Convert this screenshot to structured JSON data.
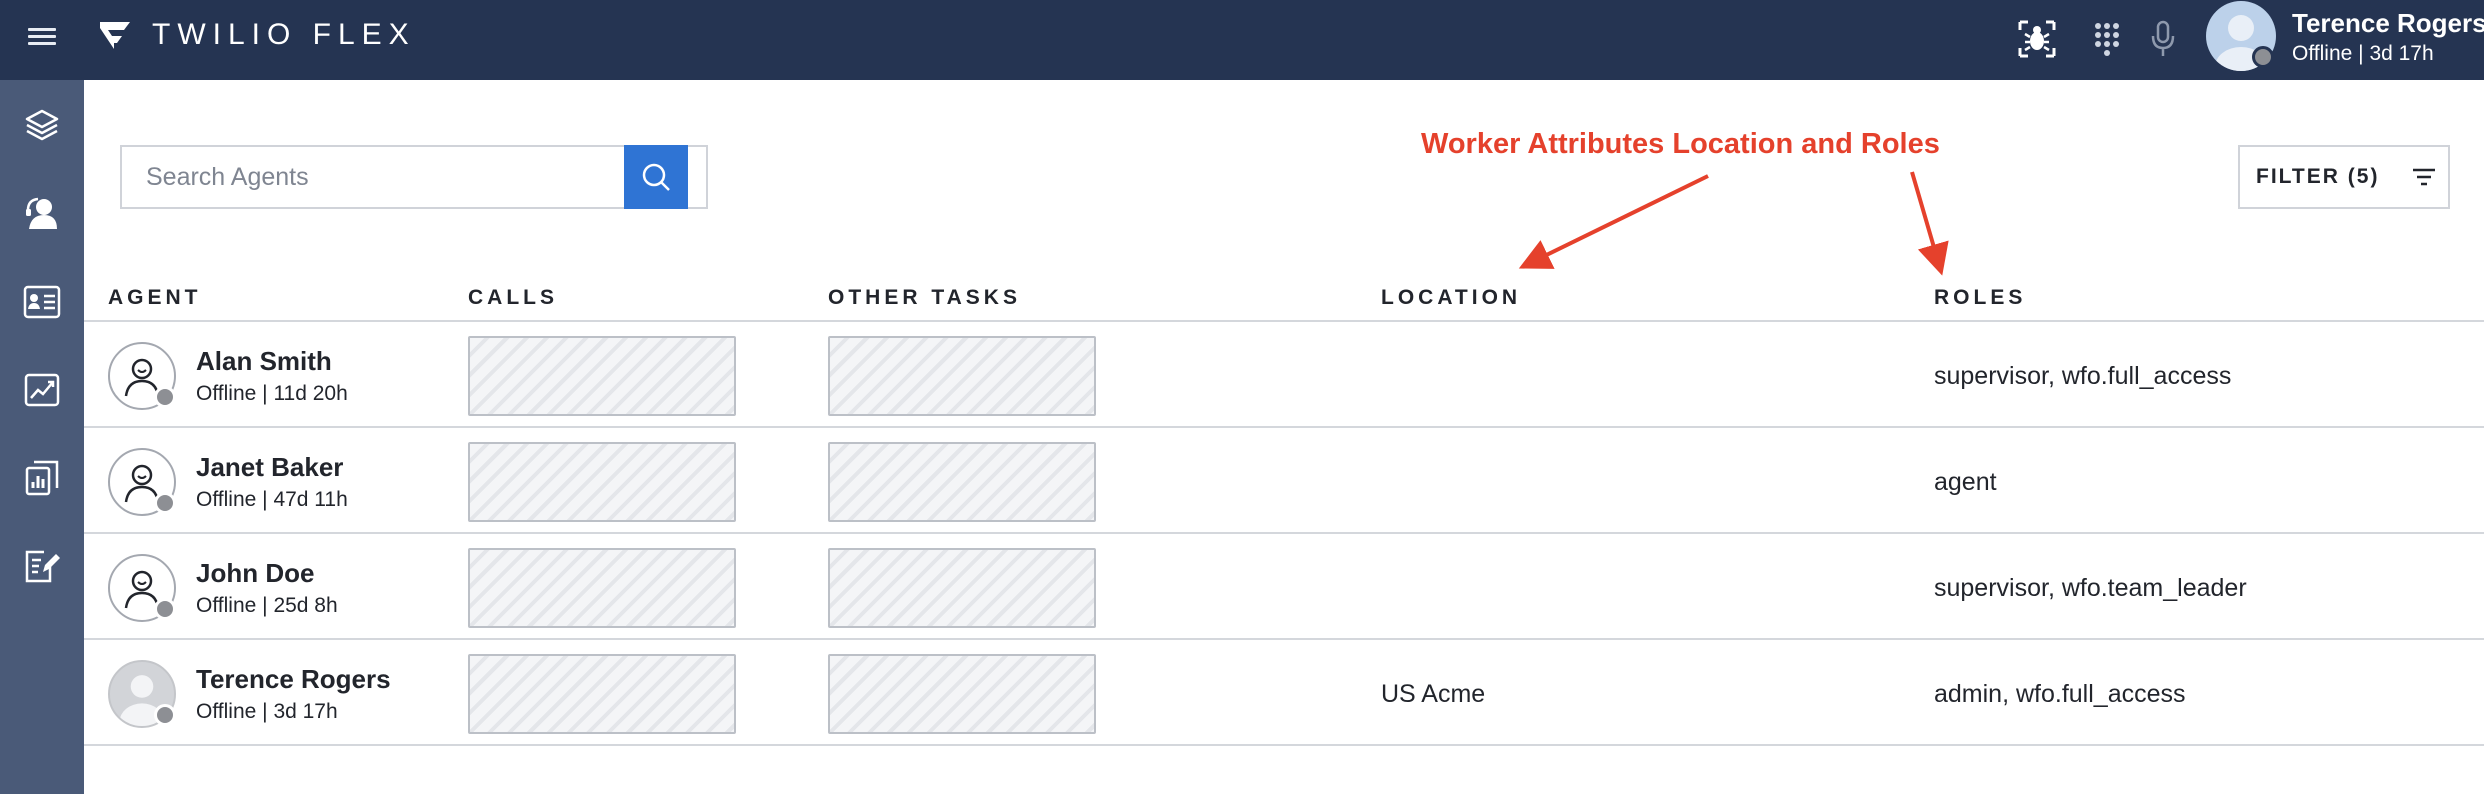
{
  "app": {
    "brand": "TWILIO FLEX"
  },
  "user": {
    "name": "Terence Rogers",
    "status": "Offline | 3d 17h"
  },
  "search": {
    "placeholder": "Search Agents"
  },
  "annotation": {
    "text": "Worker Attributes Location and Roles",
    "color": "#e5412c"
  },
  "filter": {
    "label": "FILTER (5)"
  },
  "columns": {
    "agent": "AGENT",
    "calls": "CALLS",
    "other_tasks": "OTHER TASKS",
    "location": "LOCATION",
    "roles": "ROLES"
  },
  "agents": [
    {
      "name": "Alan Smith",
      "status": "Offline | 11d 20h",
      "location": "",
      "roles": "supervisor, wfo.full_access",
      "avatar": "user-outline-icon"
    },
    {
      "name": "Janet Baker",
      "status": "Offline | 47d 11h",
      "location": "",
      "roles": "agent",
      "avatar": "user-outline-icon"
    },
    {
      "name": "John Doe",
      "status": "Offline | 25d 8h",
      "location": "",
      "roles": "supervisor, wfo.team_leader",
      "avatar": "user-outline-icon"
    },
    {
      "name": "Terence Rogers",
      "status": "Offline | 3d 17h",
      "location": "US Acme",
      "roles": "admin, wfo.full_access",
      "avatar": "user-photo-placeholder"
    }
  ],
  "sidebar_icons": [
    "layers-icon",
    "agents-icon",
    "queues-icon",
    "analytics-icon",
    "reports-icon",
    "edit-document-icon"
  ],
  "colors": {
    "topbar": "#253452",
    "sidebar": "#4a5a78",
    "accent": "#2f74d4",
    "offline": "#8d8f94"
  }
}
